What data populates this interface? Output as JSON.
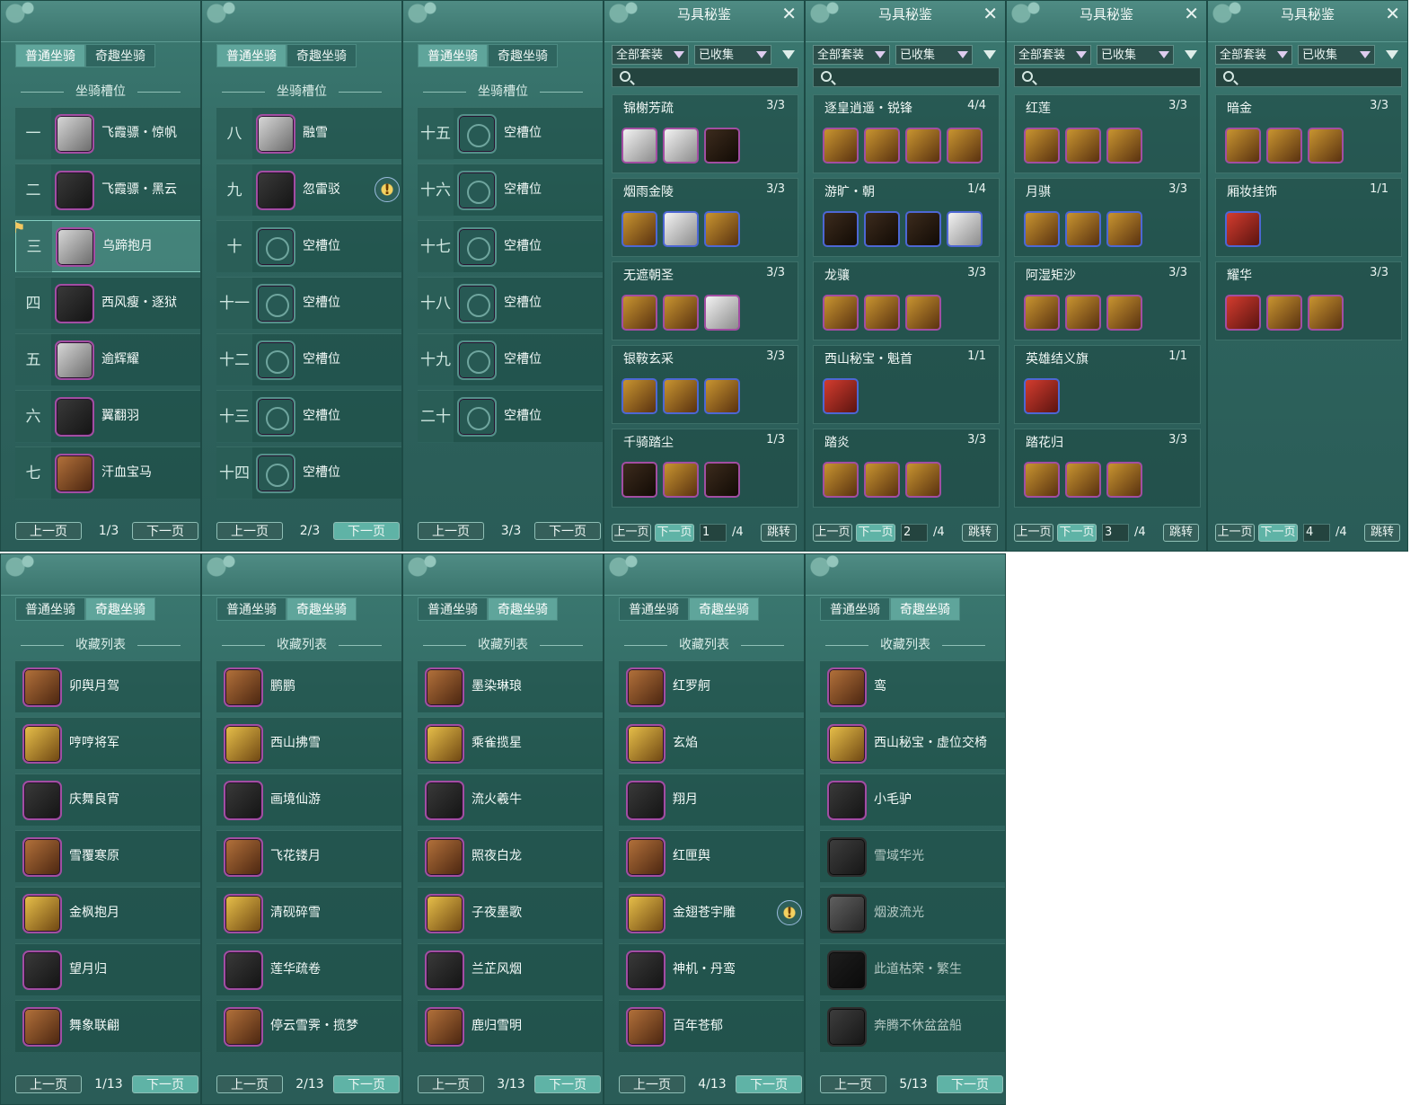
{
  "tabs": {
    "normal": "普通坐骑",
    "fun": "奇趣坐骑"
  },
  "slot_header": "坐骑槽位",
  "collection_header": "收藏列表",
  "prev": "上一页",
  "next": "下一页",
  "empty_slot": "空槽位",
  "slot_pages": [
    {
      "page": "1/3",
      "slots": [
        {
          "num": "一",
          "name": "飞霞骠・惊帆",
          "icon": "white-horse-icon"
        },
        {
          "num": "二",
          "name": "飞霞骠・黑云",
          "icon": "black-horse-icon"
        },
        {
          "num": "三",
          "name": "乌蹄抱月",
          "icon": "white-horse-icon",
          "selected": true
        },
        {
          "num": "四",
          "name": "西风瘦・逐狱",
          "icon": "black-horse-icon"
        },
        {
          "num": "五",
          "name": "逾辉耀",
          "icon": "white-horse-icon"
        },
        {
          "num": "六",
          "name": "翼翻羽",
          "icon": "black-horse-icon"
        },
        {
          "num": "七",
          "name": "汗血宝马",
          "icon": "brown-horse-icon"
        }
      ]
    },
    {
      "page": "2/3",
      "slots": [
        {
          "num": "八",
          "name": "融雪",
          "icon": "white-red-horse-icon"
        },
        {
          "num": "九",
          "name": "忽雷驳",
          "icon": "black-horse-icon",
          "alert": true
        },
        {
          "num": "十",
          "name": "空槽位",
          "empty": true
        },
        {
          "num": "十一",
          "name": "空槽位",
          "empty": true
        },
        {
          "num": "十二",
          "name": "空槽位",
          "empty": true
        },
        {
          "num": "十三",
          "name": "空槽位",
          "empty": true
        },
        {
          "num": "十四",
          "name": "空槽位",
          "empty": true
        }
      ]
    },
    {
      "page": "3/3",
      "slots": [
        {
          "num": "十五",
          "name": "空槽位",
          "empty": true
        },
        {
          "num": "十六",
          "name": "空槽位",
          "empty": true
        },
        {
          "num": "十七",
          "name": "空槽位",
          "empty": true
        },
        {
          "num": "十八",
          "name": "空槽位",
          "empty": true
        },
        {
          "num": "十九",
          "name": "空槽位",
          "empty": true
        },
        {
          "num": "二十",
          "name": "空槽位",
          "empty": true
        }
      ]
    }
  ],
  "codex": {
    "title": "马具秘鉴",
    "filter_set": "全部套装",
    "filter_collected": "已收集",
    "jump": "跳转",
    "total": "/4",
    "pages": [
      {
        "page": "1",
        "sets": [
          {
            "name": "锦榭芳疏",
            "count": "3/3",
            "items": [
              "white",
              "white",
              "dark"
            ]
          },
          {
            "name": "烟雨金陵",
            "count": "3/3",
            "items": [
              "gold",
              "white",
              "gold"
            ]
          },
          {
            "name": "无遮朝圣",
            "count": "3/3",
            "items": [
              "gold",
              "gold",
              "white"
            ]
          },
          {
            "name": "银鞍玄采",
            "count": "3/3",
            "items": [
              "gold",
              "gold",
              "gold"
            ]
          },
          {
            "name": "千骑踏尘",
            "count": "1/3",
            "items": [
              "dark",
              "gold",
              "dark"
            ]
          }
        ]
      },
      {
        "page": "2",
        "sets": [
          {
            "name": "逐皇逍遥・锐锋",
            "count": "4/4",
            "items": [
              "gold",
              "gold",
              "gold",
              "gold"
            ]
          },
          {
            "name": "游旷・朝",
            "count": "1/4",
            "items": [
              "dark",
              "dark",
              "dark",
              "white"
            ]
          },
          {
            "name": "龙骧",
            "count": "3/3",
            "items": [
              "gold",
              "gold",
              "gold"
            ]
          },
          {
            "name": "西山秘宝・魁首",
            "count": "1/1",
            "items": [
              "red"
            ]
          },
          {
            "name": "踏炎",
            "count": "3/3",
            "items": [
              "gold",
              "gold",
              "gold"
            ]
          }
        ]
      },
      {
        "page": "3",
        "sets": [
          {
            "name": "红莲",
            "count": "3/3",
            "items": [
              "gold",
              "gold",
              "gold"
            ]
          },
          {
            "name": "月骐",
            "count": "3/3",
            "items": [
              "gold",
              "gold",
              "gold"
            ]
          },
          {
            "name": "阿湿矩沙",
            "count": "3/3",
            "items": [
              "gold",
              "gold",
              "gold"
            ]
          },
          {
            "name": "英雄结义旗",
            "count": "1/1",
            "items": [
              "red"
            ]
          },
          {
            "name": "踏花归",
            "count": "3/3",
            "items": [
              "gold",
              "gold",
              "gold"
            ]
          }
        ]
      },
      {
        "page": "4",
        "sets": [
          {
            "name": "暗金",
            "count": "3/3",
            "items": [
              "gold",
              "gold",
              "gold"
            ]
          },
          {
            "name": "厢妆挂饰",
            "count": "1/1",
            "items": [
              "red"
            ]
          },
          {
            "name": "耀华",
            "count": "3/3",
            "items": [
              "red",
              "gold",
              "gold"
            ]
          }
        ]
      }
    ]
  },
  "collection_pages": [
    {
      "page": "1/13",
      "items": [
        "卯舆月驾",
        "哼哼将军",
        "庆舞良宵",
        "雪覆寒原",
        "金枫抱月",
        "望月归",
        "舞象联翩"
      ]
    },
    {
      "page": "2/13",
      "items": [
        "鹏鹏",
        "西山拂雪",
        "画境仙游",
        "飞花镂月",
        "清砚碎雪",
        "莲华疏卷",
        "停云雪霁・揽梦"
      ]
    },
    {
      "page": "3/13",
      "items": [
        "墨染琳琅",
        "乘雀揽星",
        "流火羲牛",
        "照夜白龙",
        "子夜墨歌",
        "兰芷风烟",
        "鹿归雪明"
      ]
    },
    {
      "page": "4/13",
      "items": [
        "红罗舸",
        "玄焰",
        "翔月",
        "红匣舆",
        "金翅苍宇雕",
        "神机・丹鸾",
        "百年苍郁"
      ]
    },
    {
      "page": "5/13",
      "items": [
        "鸾",
        "西山秘宝・虚位交椅",
        "小毛驴",
        "雪域华光",
        "烟波流光",
        "此道枯荣・繁生",
        "奔腾不休盆盆船"
      ]
    }
  ]
}
